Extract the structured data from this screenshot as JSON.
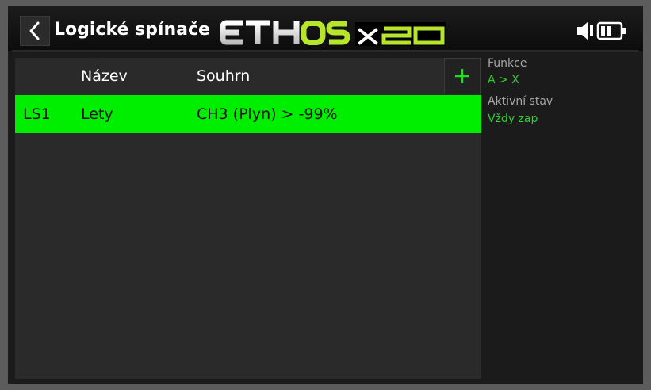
{
  "header": {
    "title": "Logické spínače",
    "logo_text": "ETHOSx20"
  },
  "icons": {
    "back": "chevron-left-icon",
    "speaker": "speaker-icon",
    "battery": "battery-icon",
    "add": "plus-icon"
  },
  "colors": {
    "accent_green": "#00ee00",
    "side_value_green": "#2fd02f",
    "logo_lime": "#b7e52b"
  },
  "table": {
    "columns": [
      "",
      "Název",
      "Souhrn"
    ],
    "rows": [
      {
        "id": "LS1",
        "name": "Lety",
        "summary": "CH3 (Plyn) > -99%",
        "selected": true
      }
    ]
  },
  "side_panel": {
    "function_label": "Funkce",
    "function_value": "A > X",
    "state_label": "Aktivní stav",
    "state_value": "Vždy zap"
  }
}
